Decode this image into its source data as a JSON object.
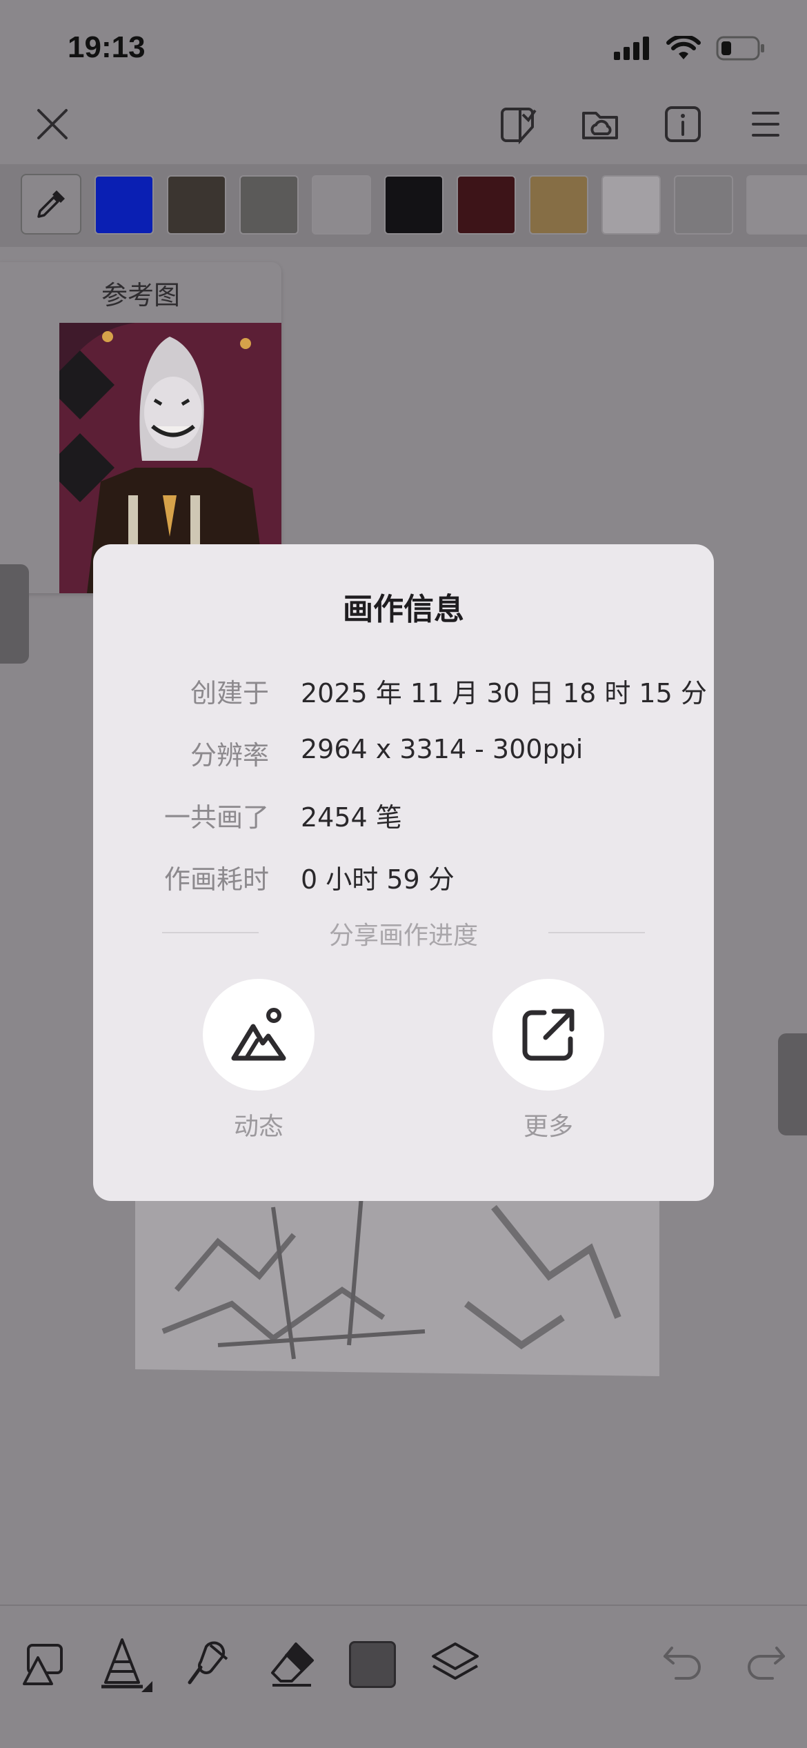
{
  "status_bar": {
    "time": "19:13"
  },
  "top_bar": {
    "close_icon": "close-icon",
    "icons": [
      "sticker-icon",
      "cloud-folder-icon",
      "info-icon",
      "menu-icon"
    ]
  },
  "palette": {
    "swatches": [
      "#0a1fb3",
      "#3b3530",
      "#5b5a59",
      "#8d8a8e",
      "#131215",
      "#3d1418",
      "#866e45",
      "#a3a0a4",
      "#7c7a7d",
      "#8f8c90"
    ]
  },
  "reference_panel": {
    "title": "参考图"
  },
  "dialog": {
    "title": "画作信息",
    "rows": [
      {
        "label": "创建于",
        "value": "2025 年 11 月 30 日 18 时 15 分"
      },
      {
        "label": "分辨率",
        "value": "2964 x 3314 - 300ppi"
      },
      {
        "label": "一共画了",
        "value": "2454 笔"
      },
      {
        "label": "作画耗时",
        "value": "0 小时 59 分"
      }
    ],
    "share_title": "分享画作进度",
    "share_buttons": [
      {
        "label": "动态",
        "icon": "mountain-image-icon"
      },
      {
        "label": "更多",
        "icon": "external-share-icon"
      }
    ]
  },
  "bottom_toolbar": {
    "tools": [
      "shapes-icon",
      "pen-tool-icon",
      "smudge-icon",
      "eraser-icon",
      "color-icon",
      "layers-icon",
      "undo-icon",
      "redo-icon"
    ],
    "current_color": "#4a484b"
  }
}
